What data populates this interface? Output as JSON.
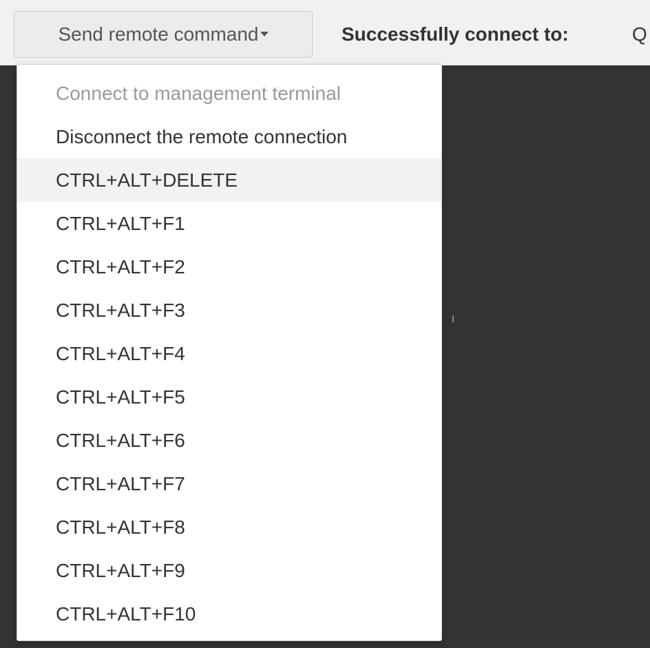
{
  "toolbar": {
    "dropdown_label": "Send remote command",
    "status_label": "Successfully connect to:",
    "status_target": "Q"
  },
  "menu": {
    "items": [
      {
        "label": "Connect to management terminal",
        "state": "disabled"
      },
      {
        "label": "Disconnect the remote connection",
        "state": "normal"
      },
      {
        "label": "CTRL+ALT+DELETE",
        "state": "hover"
      },
      {
        "label": "CTRL+ALT+F1",
        "state": "normal"
      },
      {
        "label": "CTRL+ALT+F2",
        "state": "normal"
      },
      {
        "label": "CTRL+ALT+F3",
        "state": "normal"
      },
      {
        "label": "CTRL+ALT+F4",
        "state": "normal"
      },
      {
        "label": "CTRL+ALT+F5",
        "state": "normal"
      },
      {
        "label": "CTRL+ALT+F6",
        "state": "normal"
      },
      {
        "label": "CTRL+ALT+F7",
        "state": "normal"
      },
      {
        "label": "CTRL+ALT+F8",
        "state": "normal"
      },
      {
        "label": "CTRL+ALT+F9",
        "state": "normal"
      },
      {
        "label": "CTRL+ALT+F10",
        "state": "normal"
      }
    ]
  },
  "colors": {
    "toolbar_bg": "#f1f1f1",
    "screen_bg": "#333333",
    "menu_bg": "#ffffff",
    "hover_bg": "#f2f2f2",
    "disabled_text": "#9a9a9a"
  },
  "icons": {
    "dropdown_caret": "caret-down-icon"
  }
}
